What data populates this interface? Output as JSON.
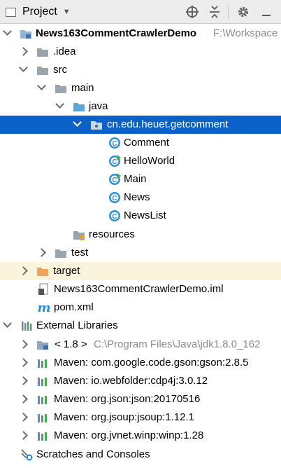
{
  "header": {
    "title": "Project"
  },
  "tree": {
    "root": {
      "name": "News163CommentCrawlerDemo",
      "path": "F:\\Workspace"
    },
    "idea": ".idea",
    "src": "src",
    "main": "main",
    "java": "java",
    "package": "cn.edu.heuet.getcomment",
    "classes": [
      "Comment",
      "HelloWorld",
      "Main",
      "News",
      "NewsList"
    ],
    "resources": "resources",
    "test": "test",
    "target": "target",
    "iml": "News163CommentCrawlerDemo.iml",
    "pom": "pom.xml",
    "ext_libs": "External Libraries",
    "jdk": {
      "label": "< 1.8 >",
      "path": "C:\\Program Files\\Java\\jdk1.8.0_162"
    },
    "libs": [
      "Maven: com.google.code.gson:gson:2.8.5",
      "Maven: io.webfolder:cdp4j:3.0.12",
      "Maven: org.json:json:20170516",
      "Maven: org.jsoup:jsoup:1.12.1",
      "Maven: org.jvnet.winp:winp:1.28"
    ],
    "scratches": "Scratches and Consoles"
  },
  "colors": {
    "selection": "#0a61c8",
    "folder": "#8fb6d9",
    "source_folder": "#5fa4d9",
    "target_folder": "#f0a25a",
    "class_icon": "#2a8fd6"
  }
}
